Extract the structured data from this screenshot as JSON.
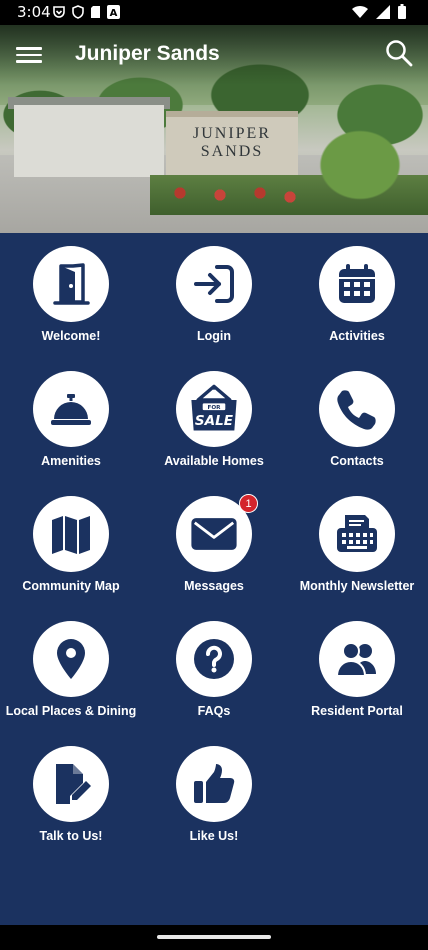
{
  "status_bar": {
    "time": "3:04",
    "icons": [
      "pocket-icon",
      "shield-icon",
      "sd-card-icon",
      "font-a-icon",
      "wifi-icon",
      "signal-icon",
      "battery-icon"
    ]
  },
  "app_bar": {
    "title": "Juniper Sands",
    "menu_icon": "hamburger-menu-icon",
    "search_icon": "search-icon"
  },
  "hero": {
    "sign_text_line1": "JUNIPER",
    "sign_text_line2": "SANDS"
  },
  "grid": {
    "tiles": [
      {
        "label": "Welcome!",
        "icon": "door-open-icon"
      },
      {
        "label": "Login",
        "icon": "sign-in-icon"
      },
      {
        "label": "Activities",
        "icon": "calendar-icon"
      },
      {
        "label": "Amenities",
        "icon": "concierge-bell-icon"
      },
      {
        "label": "Available Homes",
        "icon": "for-sale-sign-icon",
        "sign_small": "FOR",
        "sign_big": "SALE"
      },
      {
        "label": "Contacts",
        "icon": "phone-icon"
      },
      {
        "label": "Community Map",
        "icon": "map-icon"
      },
      {
        "label": "Messages",
        "icon": "envelope-icon",
        "badge": "1"
      },
      {
        "label": "Monthly Newsletter",
        "icon": "typewriter-icon"
      },
      {
        "label": "Local Places & Dining",
        "icon": "map-pin-icon"
      },
      {
        "label": "FAQs",
        "icon": "question-icon"
      },
      {
        "label": "Resident Portal",
        "icon": "users-icon"
      },
      {
        "label": "Talk to Us!",
        "icon": "file-edit-icon"
      },
      {
        "label": "Like Us!",
        "icon": "thumbs-up-icon"
      }
    ]
  },
  "colors": {
    "grid_background": "#1b3260",
    "icon_color": "#1b3260",
    "badge": "#d4252c"
  }
}
